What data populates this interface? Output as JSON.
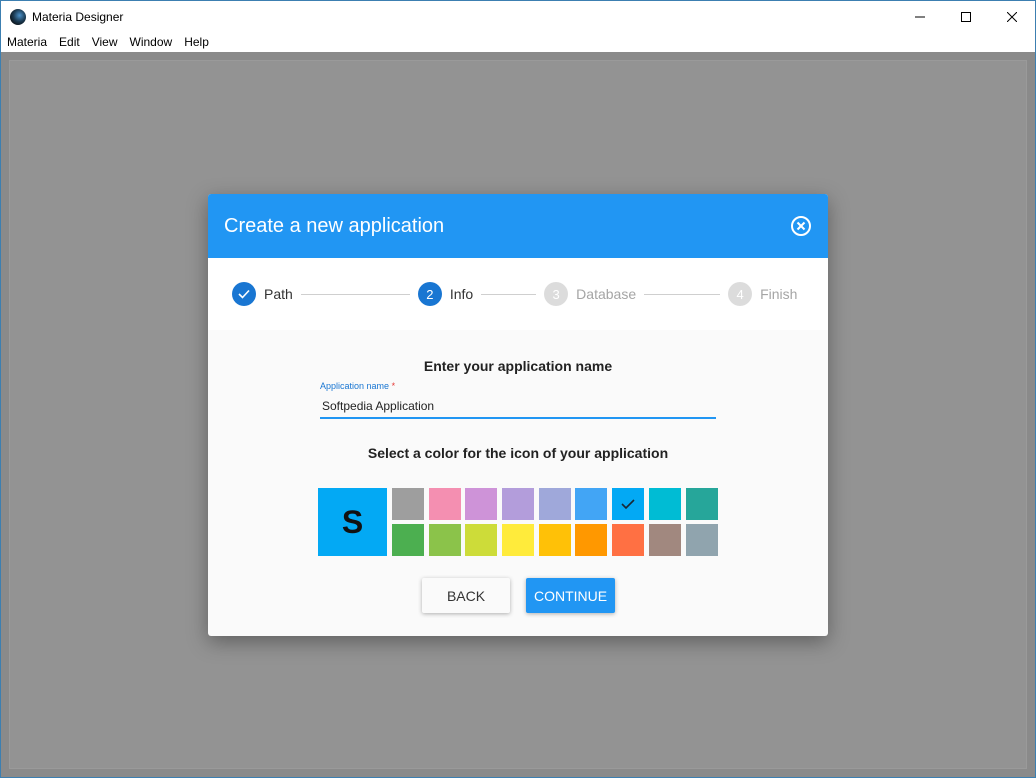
{
  "window": {
    "title": "Materia Designer",
    "icon": "materia-logo-icon"
  },
  "menu": {
    "items": [
      {
        "label": "Materia"
      },
      {
        "label": "Edit"
      },
      {
        "label": "View"
      },
      {
        "label": "Window"
      },
      {
        "label": "Help"
      }
    ]
  },
  "dialog": {
    "title": "Create a new application",
    "close_icon": "close-circle-icon",
    "steps": [
      {
        "number": "",
        "label": "Path",
        "state": "done"
      },
      {
        "number": "2",
        "label": "Info",
        "state": "active"
      },
      {
        "number": "3",
        "label": "Database",
        "state": "pending"
      },
      {
        "number": "4",
        "label": "Finish",
        "state": "pending"
      }
    ],
    "name_heading": "Enter your application name",
    "name_field": {
      "label": "Application name",
      "required_mark": "*",
      "value": "Softpedia Application"
    },
    "color_heading": "Select a color for the icon of your application",
    "preview_letter": "S",
    "preview_color": "#03a9f4",
    "selected_color": "#03a9f4",
    "colors": [
      "#9e9e9e",
      "#f48fb1",
      "#ce93d8",
      "#b39ddb",
      "#9fa8da",
      "#42a5f5",
      "#03a9f4",
      "#00bcd4",
      "#26a69a",
      "#4caf50",
      "#8bc34a",
      "#cddc39",
      "#ffeb3b",
      "#ffc107",
      "#ff9800",
      "#ff7043",
      "#a1887f",
      "#90a4ae"
    ],
    "back_label": "BACK",
    "continue_label": "CONTINUE",
    "accent_color": "#2196f3"
  }
}
